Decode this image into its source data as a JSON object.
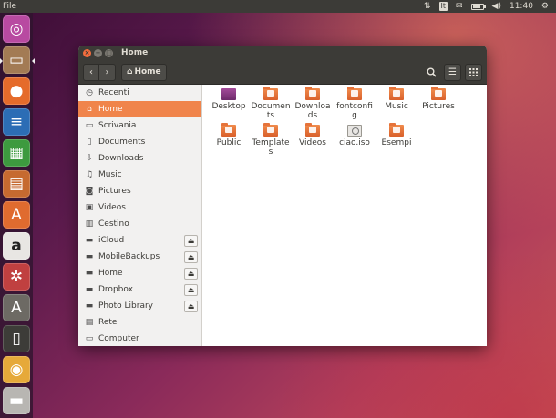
{
  "topbar": {
    "menu": "File",
    "lang": "It",
    "time": "11:40",
    "battery_fraction": 0.8
  },
  "launcher": {
    "items": [
      {
        "name": "ubuntu-logo-icon",
        "color": "#b84aa1"
      },
      {
        "name": "files-icon",
        "color": "#a37b54"
      },
      {
        "name": "firefox-icon",
        "color": "#e56b2b"
      },
      {
        "name": "writer-icon",
        "color": "#2c6db5"
      },
      {
        "name": "calc-icon",
        "color": "#3d9a3f"
      },
      {
        "name": "impress-icon",
        "color": "#c66a30"
      },
      {
        "name": "software-center-icon",
        "color": "#e06b2f"
      },
      {
        "name": "amazon-icon",
        "color": "#e8e6e3"
      },
      {
        "name": "settings-icon",
        "color": "#c04040"
      },
      {
        "name": "updater-icon",
        "color": "#6d6a64"
      },
      {
        "name": "usb-icon",
        "color": "#3d3c38"
      },
      {
        "name": "disc-icon",
        "color": "#e6a93a"
      },
      {
        "name": "drive-icon",
        "color": "#b8b6b2"
      }
    ]
  },
  "window": {
    "title": "Home",
    "crumb": "Home"
  },
  "sidebar": {
    "items": [
      {
        "label": "Recenti",
        "icon": "clock-icon"
      },
      {
        "label": "Home",
        "icon": "home-icon",
        "active": true
      },
      {
        "label": "Scrivania",
        "icon": "folder-icon"
      },
      {
        "label": "Documents",
        "icon": "document-icon"
      },
      {
        "label": "Downloads",
        "icon": "download-icon"
      },
      {
        "label": "Music",
        "icon": "music-icon"
      },
      {
        "label": "Pictures",
        "icon": "camera-icon"
      },
      {
        "label": "Videos",
        "icon": "video-icon"
      },
      {
        "label": "Cestino",
        "icon": "trash-icon"
      },
      {
        "label": "iCloud",
        "icon": "drive-icon",
        "eject": true
      },
      {
        "label": "MobileBackups",
        "icon": "drive-icon",
        "eject": true
      },
      {
        "label": "Home",
        "icon": "drive-icon",
        "eject": true
      },
      {
        "label": "Dropbox",
        "icon": "drive-icon",
        "eject": true
      },
      {
        "label": "Photo Library",
        "icon": "drive-icon",
        "eject": true
      },
      {
        "label": "Rete",
        "icon": "network-icon"
      },
      {
        "label": "Computer",
        "icon": "computer-icon"
      }
    ]
  },
  "files": [
    {
      "name": "Desktop",
      "kind": "desk"
    },
    {
      "name": "Documents",
      "kind": "folder"
    },
    {
      "name": "Downloads",
      "kind": "folder"
    },
    {
      "name": "fontconfig",
      "kind": "folder"
    },
    {
      "name": "Music",
      "kind": "folder"
    },
    {
      "name": "Pictures",
      "kind": "folder"
    },
    {
      "name": "Public",
      "kind": "folder"
    },
    {
      "name": "Templates",
      "kind": "folder"
    },
    {
      "name": "Videos",
      "kind": "folder"
    },
    {
      "name": "ciao.iso",
      "kind": "iso"
    },
    {
      "name": "Esempi",
      "kind": "folder"
    }
  ]
}
